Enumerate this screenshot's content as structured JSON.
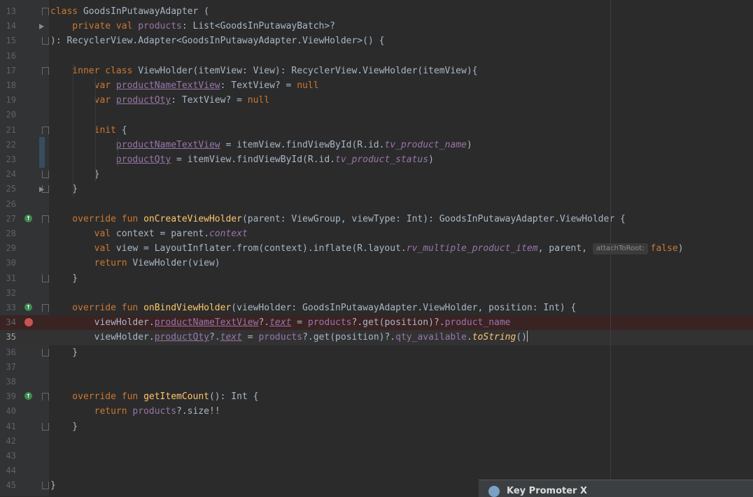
{
  "lines": [
    {
      "num": "13",
      "segs": [
        {
          "t": "class ",
          "c": "k"
        },
        {
          "t": "GoodsInPutawayAdapter ("
        }
      ]
    },
    {
      "num": "14",
      "segs": [
        {
          "t": "    private val ",
          "c": "k"
        },
        {
          "t": "products",
          "c": "p"
        },
        {
          "t": ": List<GoodsInPutawayBatch>?"
        }
      ]
    },
    {
      "num": "15",
      "segs": [
        {
          "t": "): RecyclerView.Adapter<GoodsInPutawayAdapter.ViewHolder>() {"
        }
      ]
    },
    {
      "num": "16",
      "segs": []
    },
    {
      "num": "17",
      "segs": [
        {
          "t": "    inner class ",
          "c": "k"
        },
        {
          "t": "ViewHolder(itemView: View): RecyclerView.ViewHolder(itemView){"
        }
      ]
    },
    {
      "num": "18",
      "segs": [
        {
          "t": "        var ",
          "c": "k"
        },
        {
          "t": "productNameTextView",
          "c": "pu"
        },
        {
          "t": ": TextView? = "
        },
        {
          "t": "null",
          "c": "k"
        }
      ]
    },
    {
      "num": "19",
      "segs": [
        {
          "t": "        var ",
          "c": "k"
        },
        {
          "t": "productQty",
          "c": "pu"
        },
        {
          "t": ": TextView? = "
        },
        {
          "t": "null",
          "c": "k"
        }
      ]
    },
    {
      "num": "20",
      "segs": []
    },
    {
      "num": "21",
      "segs": [
        {
          "t": "        init ",
          "c": "k"
        },
        {
          "t": "{"
        }
      ]
    },
    {
      "num": "22",
      "segs": [
        {
          "t": "            "
        },
        {
          "t": "productNameTextView",
          "c": "pu"
        },
        {
          "t": " = itemView.findViewById(R.id."
        },
        {
          "t": "tv_product_name",
          "c": "it"
        },
        {
          "t": ")"
        }
      ]
    },
    {
      "num": "23",
      "segs": [
        {
          "t": "            "
        },
        {
          "t": "productQty",
          "c": "pu"
        },
        {
          "t": " = itemView.findViewById(R.id."
        },
        {
          "t": "tv_product_status",
          "c": "it"
        },
        {
          "t": ")"
        }
      ]
    },
    {
      "num": "24",
      "segs": [
        {
          "t": "        }"
        }
      ]
    },
    {
      "num": "25",
      "segs": [
        {
          "t": "    }"
        }
      ]
    },
    {
      "num": "26",
      "segs": []
    },
    {
      "num": "27",
      "segs": [
        {
          "t": "    override fun ",
          "c": "k"
        },
        {
          "t": "onCreateViewHolder",
          "c": "fn"
        },
        {
          "t": "(parent: ViewGroup, viewType: Int): GoodsInPutawayAdapter.ViewHolder {"
        }
      ]
    },
    {
      "num": "28",
      "segs": [
        {
          "t": "        val ",
          "c": "k"
        },
        {
          "t": "context = parent."
        },
        {
          "t": "context",
          "c": "it"
        }
      ]
    },
    {
      "num": "29",
      "segs": [
        {
          "t": "        val ",
          "c": "k"
        },
        {
          "t": "view = LayoutInflater.from(context).inflate(R.layout."
        },
        {
          "t": "rv_multiple_product_item",
          "c": "it"
        },
        {
          "t": ", parent,"
        },
        {
          "hint": "attachToRoot:"
        },
        {
          "t": "false",
          "c": "k"
        },
        {
          "t": ")"
        }
      ]
    },
    {
      "num": "30",
      "segs": [
        {
          "t": "        return ",
          "c": "k"
        },
        {
          "t": "ViewHolder(view)"
        }
      ]
    },
    {
      "num": "31",
      "segs": [
        {
          "t": "    }"
        }
      ]
    },
    {
      "num": "32",
      "segs": []
    },
    {
      "num": "33",
      "segs": [
        {
          "t": "    override fun ",
          "c": "k"
        },
        {
          "t": "onBindViewHolder",
          "c": "fn"
        },
        {
          "t": "(viewHolder: GoodsInPutawayAdapter.ViewHolder, position: Int) {"
        }
      ]
    },
    {
      "num": "34",
      "segs": [
        {
          "t": "        viewHolder."
        },
        {
          "t": "productNameTextView",
          "c": "pu"
        },
        {
          "t": "?."
        },
        {
          "t": "text",
          "c": "itu"
        },
        {
          "t": " = "
        },
        {
          "t": "products",
          "c": "p"
        },
        {
          "t": "?.get(position)?."
        },
        {
          "t": "product_name",
          "c": "p"
        }
      ]
    },
    {
      "num": "35",
      "segs": [
        {
          "t": "        viewHolder."
        },
        {
          "t": "productQty",
          "c": "pu"
        },
        {
          "t": "?."
        },
        {
          "t": "text",
          "c": "itu"
        },
        {
          "t": " = "
        },
        {
          "t": "products",
          "c": "p"
        },
        {
          "t": "?.get(position)?."
        },
        {
          "t": "qty_available",
          "c": "p"
        },
        {
          "t": "."
        },
        {
          "t": "toString",
          "c": "fni"
        },
        {
          "t": "()"
        },
        {
          "caret": true
        }
      ]
    },
    {
      "num": "36",
      "segs": [
        {
          "t": "    }"
        }
      ]
    },
    {
      "num": "37",
      "segs": []
    },
    {
      "num": "38",
      "segs": []
    },
    {
      "num": "39",
      "segs": [
        {
          "t": "    override fun ",
          "c": "k"
        },
        {
          "t": "getItemCount",
          "c": "fn"
        },
        {
          "t": "(): Int {"
        }
      ]
    },
    {
      "num": "40",
      "segs": [
        {
          "t": "        return ",
          "c": "k"
        },
        {
          "t": "products",
          "c": "p"
        },
        {
          "t": "?.size!!"
        }
      ]
    },
    {
      "num": "41",
      "segs": [
        {
          "t": "    }"
        }
      ]
    },
    {
      "num": "42",
      "segs": []
    },
    {
      "num": "43",
      "segs": []
    },
    {
      "num": "44",
      "segs": []
    },
    {
      "num": "45",
      "segs": [
        {
          "t": "}"
        }
      ]
    }
  ],
  "tooltip": {
    "title": "Key Promoter X"
  },
  "colors": {
    "background": "#2b2b2b",
    "keyword": "#cc7832",
    "property": "#9876aa",
    "function": "#ffc66d",
    "text": "#a9b7c6",
    "breakpoint": "#c75450"
  }
}
